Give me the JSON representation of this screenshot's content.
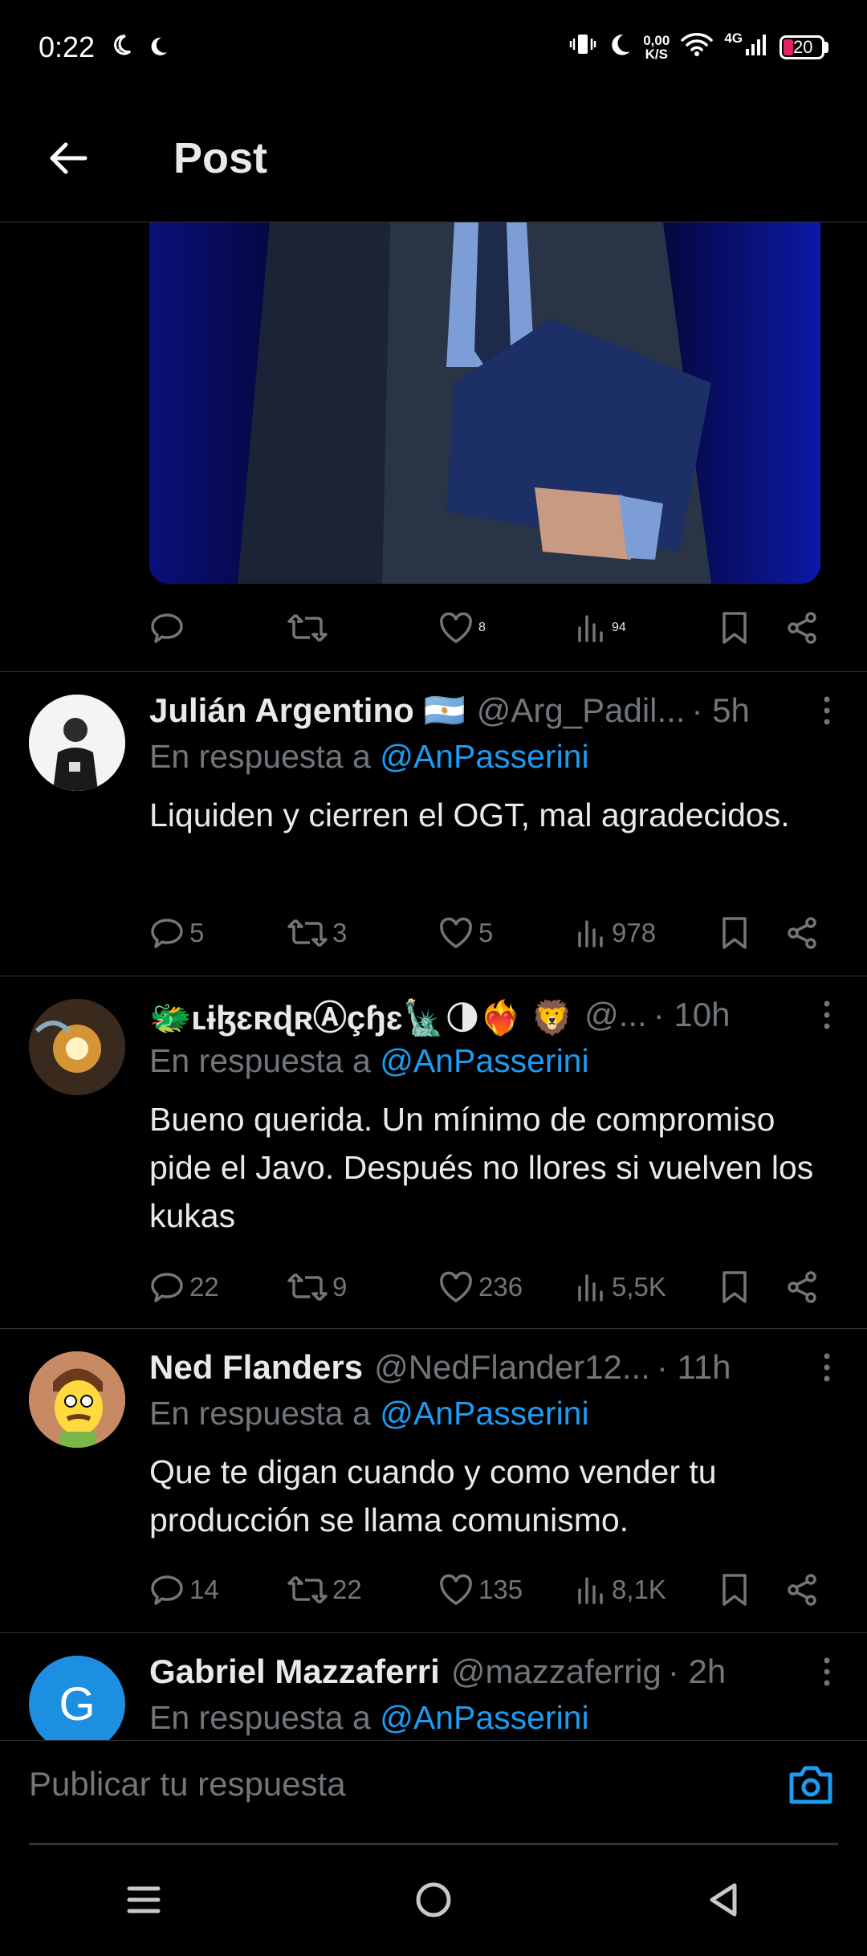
{
  "status_bar": {
    "time": "0:22",
    "net_speed_value": "0,00",
    "net_speed_unit": "K/S",
    "network": "4G",
    "battery": "20"
  },
  "header": {
    "title": "Post"
  },
  "media_post": {
    "likes": "8",
    "views": "94"
  },
  "replies": [
    {
      "name": "Julián Argentino 🇦🇷",
      "handle": "@Arg_Padil...",
      "time": "· 5h",
      "reply_prefix": "En respuesta a",
      "reply_to": "@AnPasserini",
      "text": "Liquiden y cierren el OGT, mal agradecidos.",
      "comments": "5",
      "retweets": "3",
      "likes": "5",
      "views": "978"
    },
    {
      "name": "🐲ʟɨɮɛʀɖʀⒶçɧɛ🗽🌗❤️‍🔥 🦁",
      "handle": "@...",
      "time": "· 10h",
      "reply_prefix": "En respuesta a",
      "reply_to": "@AnPasserini",
      "text": "Bueno querida. Un mínimo de compromiso pide el Javo. Después no llores si vuelven los kukas",
      "comments": "22",
      "retweets": "9",
      "likes": "236",
      "views": "5,5K"
    },
    {
      "name": "Ned Flanders",
      "handle": "@NedFlander12...",
      "time": "· 11h",
      "reply_prefix": "En respuesta a",
      "reply_to": "@AnPasserini",
      "text": "Que te digan cuando y como vender tu producción se llama comunismo.",
      "comments": "14",
      "retweets": "22",
      "likes": "135",
      "views": "8,1K"
    },
    {
      "name": "Gabriel Mazzaferri",
      "handle": "@mazzaferrig",
      "time": "· 2h",
      "reply_prefix": "En respuesta a",
      "reply_to": "@AnPasserini",
      "avatar_letter": "G"
    }
  ],
  "composer": {
    "placeholder": "Publicar tu respuesta"
  },
  "colors": {
    "accent": "#1d9bf0",
    "secondary_text": "#71767b",
    "background": "#000000",
    "divider": "#2f3336"
  }
}
